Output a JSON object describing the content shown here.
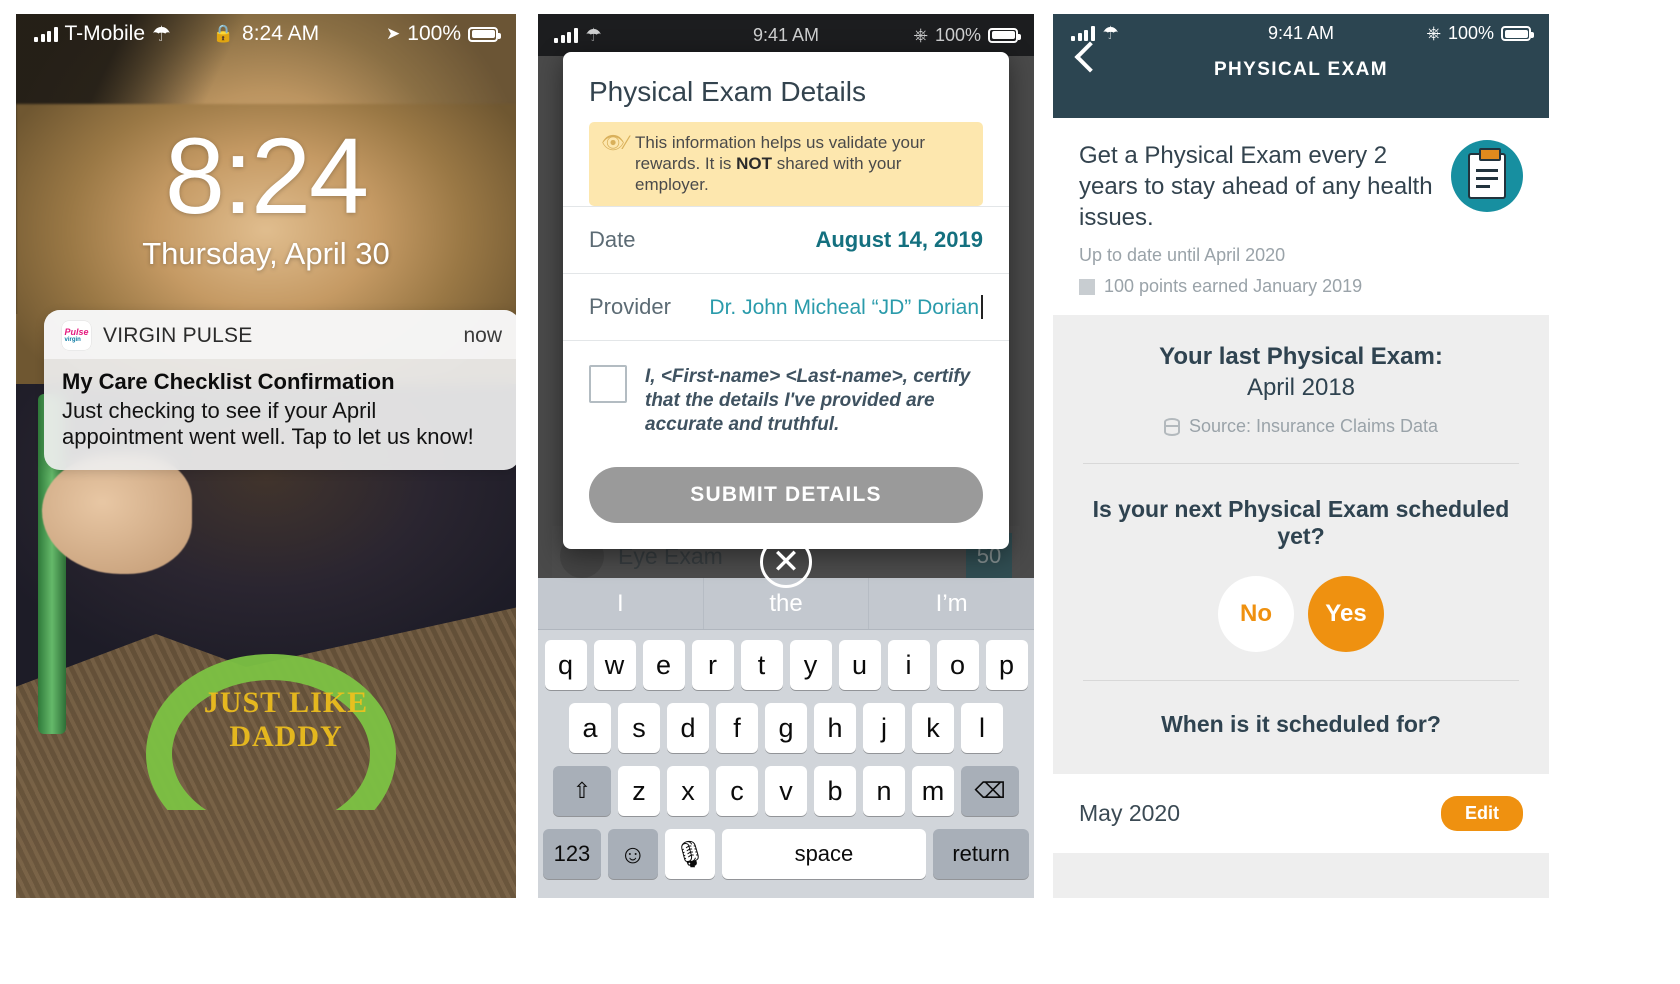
{
  "phone1": {
    "status_bar": {
      "carrier": "T-Mobile",
      "wifi_icon": "wifi-icon",
      "lock_icon": "lock-icon",
      "time": "8:24 AM",
      "location_icon": "location-arrow-icon",
      "battery_percent": "100%",
      "battery_icon": "battery-full-icon"
    },
    "lock_screen": {
      "time": "8:24",
      "date": "Thursday, April 30"
    },
    "notification": {
      "app_icon": "virgin-pulse-app-icon",
      "app_name": "VIRGIN PULSE",
      "timestamp": "now",
      "title": "My Care Checklist Confirmation",
      "message": "Just checking to see if your April appointment went well. Tap to let us know!"
    }
  },
  "phone2": {
    "status_bar": {
      "time": "9:41 AM",
      "bluetooth_icon": "bluetooth-icon",
      "battery_percent": "100%"
    },
    "modal": {
      "title": "Physical Exam Details",
      "notice_icon": "eye-slash-icon",
      "notice_text_before": "This information helps us validate your rewards. It is ",
      "notice_text_bold": "NOT",
      "notice_text_after": " shared with your employer.",
      "fields": [
        {
          "label": "Date",
          "value": "August 14, 2019"
        },
        {
          "label": "Provider",
          "value": "Dr. John Micheal “JD” Dorian"
        }
      ],
      "certify_text": "I, <First-name> <Last-name>, certify that the details I've provided are accurate and truthful.",
      "checkbox_state": "unchecked",
      "submit_label": "SUBMIT DETAILS"
    },
    "background_list": {
      "item_title": "Eye Exam",
      "item_points": "50"
    },
    "close_icon": "close-x-icon",
    "keyboard": {
      "suggestions": [
        "I",
        "the",
        "I’m"
      ],
      "row1": [
        "q",
        "w",
        "e",
        "r",
        "t",
        "y",
        "u",
        "i",
        "o",
        "p"
      ],
      "row2": [
        "a",
        "s",
        "d",
        "f",
        "g",
        "h",
        "j",
        "k",
        "l"
      ],
      "row3_shift_icon": "shift-arrow-icon",
      "row3": [
        "z",
        "x",
        "c",
        "v",
        "b",
        "n",
        "m"
      ],
      "row3_backspace_icon": "backspace-icon",
      "numbers_key": "123",
      "emoji_icon": "smiley-face-icon",
      "mic_icon": "microphone-icon",
      "space_key": "space",
      "return_key": "return"
    }
  },
  "phone3": {
    "status_bar": {
      "time": "9:41 AM",
      "bluetooth_icon": "bluetooth-icon",
      "battery_percent": "100%"
    },
    "nav": {
      "back_icon": "chevron-left-icon",
      "title": "PHYSICAL EXAM"
    },
    "intro": {
      "headline": "Get a Physical Exam every 2 years to stay ahead of any health issues.",
      "subtext": "Up to date until April 2020",
      "points_text": "100 points earned January 2019",
      "badge_icon": "clipboard-icon"
    },
    "last_exam_card": {
      "title": "Your last Physical Exam:",
      "date": "April 2018",
      "source_icon": "database-icon",
      "source": "Source: Insurance Claims Data"
    },
    "scheduled_question": {
      "question": "Is your next Physical Exam scheduled yet?",
      "options": [
        {
          "label": "No",
          "selected": false
        },
        {
          "label": "Yes",
          "selected": true
        }
      ]
    },
    "when_question": {
      "question": "When is it scheduled for?",
      "value": "May 2020",
      "edit_label": "Edit"
    }
  },
  "colors": {
    "header_dark": "#2c4551",
    "accent_orange": "#ef9110",
    "teal": "#178fa0",
    "link_teal": "#2a9bab",
    "value_bold_teal": "#14707f",
    "notice_yellow": "#fde7ae",
    "card_gray": "#eeeeee",
    "submit_gray": "#9a9a9a"
  }
}
